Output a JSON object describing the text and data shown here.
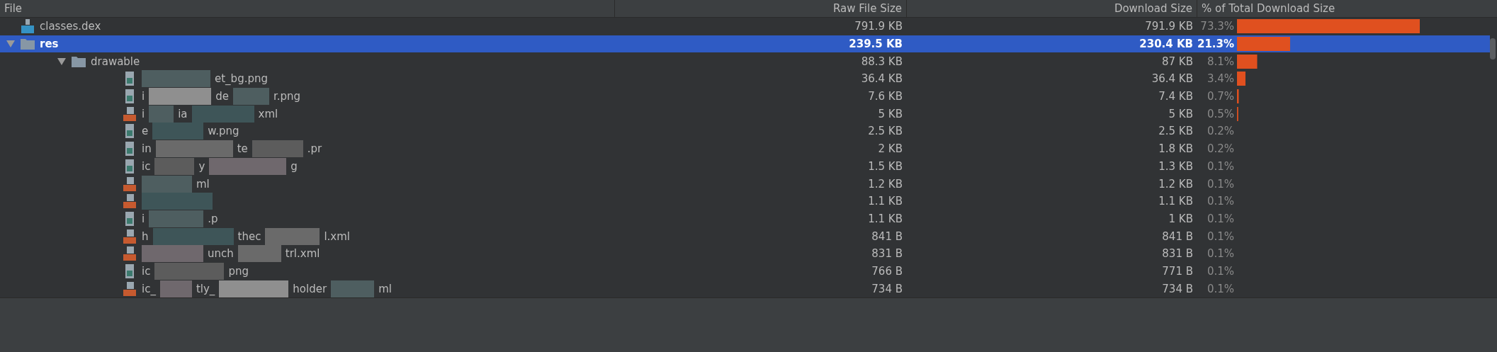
{
  "columns": [
    "File",
    "Raw File Size",
    "Download Size",
    "% of Total Download Size"
  ],
  "rows": [
    {
      "kind": "dex",
      "fragments": [
        "classes.dex"
      ],
      "raw": "791.9 KB",
      "download": "791.9 KB",
      "percent": "73.3%",
      "level": 0.733,
      "selected": false
    },
    {
      "kind": "folder",
      "fragments": [
        "res"
      ],
      "raw": "239.5 KB",
      "download": "230.4 KB",
      "percent": "21.3%",
      "level": 0.213,
      "selected": true,
      "expanded": true,
      "children": [
        {
          "kind": "folder",
          "fragments": [
            "drawable"
          ],
          "raw": "88.3 KB",
          "download": "87 KB",
          "percent": "8.1%",
          "level": 0.081,
          "selected": false,
          "expanded": true,
          "children": [
            {
              "kind": "image",
              "masked_start": true,
              "fragments": [
                "et_bg.png"
              ],
              "raw": "36.4 KB",
              "download": "36.4 KB",
              "percent": "3.4%",
              "level": 0.034,
              "selected": false
            },
            {
              "kind": "image",
              "fragments": [
                "i",
                "de",
                "r.png"
              ],
              "raw": "7.6 KB",
              "download": "7.4 KB",
              "percent": "0.7%",
              "level": 0.007,
              "selected": false
            },
            {
              "kind": "xml",
              "fragments": [
                "i",
                "ia",
                "xml"
              ],
              "raw": "5 KB",
              "download": "5 KB",
              "percent": "0.5%",
              "level": 0.005,
              "selected": false
            },
            {
              "kind": "image",
              "fragments": [
                "e",
                "w.png"
              ],
              "raw": "2.5 KB",
              "download": "2.5 KB",
              "percent": "0.2%",
              "selected": false
            },
            {
              "kind": "image",
              "fragments": [
                "in",
                "te",
                ".pr"
              ],
              "raw": "2 KB",
              "download": "1.8 KB",
              "percent": "0.2%",
              "selected": false
            },
            {
              "kind": "image",
              "fragments": [
                "ic",
                "y",
                "g"
              ],
              "raw": "1.5 KB",
              "download": "1.3 KB",
              "percent": "0.1%",
              "selected": false
            },
            {
              "kind": "xml",
              "masked_start": true,
              "fragments": [
                "ml"
              ],
              "raw": "1.2 KB",
              "download": "1.2 KB",
              "percent": "0.1%",
              "selected": false
            },
            {
              "kind": "xml",
              "masked_start": true,
              "raw": "1.1 KB",
              "download": "1.1 KB",
              "percent": "0.1%",
              "selected": false
            },
            {
              "kind": "image",
              "fragments": [
                "i",
                ".p"
              ],
              "raw": "1.1 KB",
              "download": "1 KB",
              "percent": "0.1%",
              "selected": false
            },
            {
              "kind": "xml",
              "fragments": [
                "h",
                "thec",
                "l.xml"
              ],
              "raw": "841 B",
              "download": "841 B",
              "percent": "0.1%",
              "selected": false
            },
            {
              "kind": "xml",
              "masked_start": true,
              "fragments": [
                "unch",
                "trl.xml"
              ],
              "raw": "831 B",
              "download": "831 B",
              "percent": "0.1%",
              "selected": false
            },
            {
              "kind": "image",
              "fragments": [
                "ic",
                "png"
              ],
              "raw": "766 B",
              "download": "771 B",
              "percent": "0.1%",
              "selected": false
            },
            {
              "kind": "xml",
              "fragments": [
                "ic_",
                "tly_",
                "holder",
                "ml"
              ],
              "raw": "734 B",
              "download": "734 B",
              "percent": "0.1%",
              "selected": false
            }
          ]
        }
      ]
    }
  ]
}
